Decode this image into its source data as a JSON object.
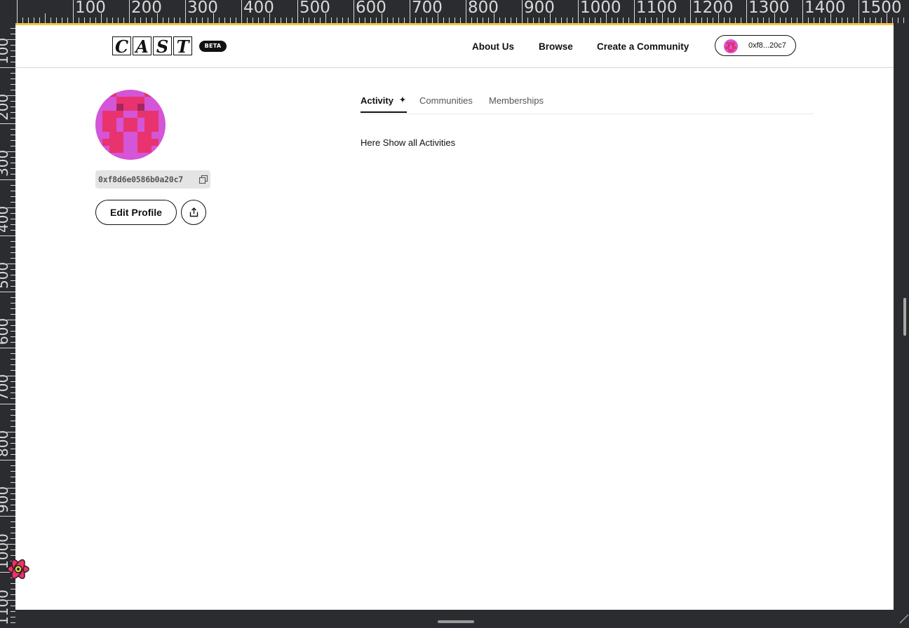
{
  "ruler": {
    "top_labels": [
      "100",
      "200",
      "300",
      "400",
      "500",
      "600",
      "700",
      "800",
      "900",
      "1000",
      "1100",
      "1200",
      "1300",
      "1400",
      "1500"
    ],
    "left_labels": [
      "100",
      "200",
      "300",
      "400",
      "500",
      "600",
      "700",
      "800",
      "900",
      "1000",
      "1100"
    ]
  },
  "header": {
    "logo_letters": [
      "C",
      "A",
      "S",
      "T"
    ],
    "beta_label": "BETA",
    "nav": {
      "about": "About Us",
      "browse": "Browse",
      "create": "Create a Community"
    },
    "wallet": {
      "address_short": "0xf8...20c7"
    }
  },
  "profile": {
    "address": "0xf8d6e0586b0a20c7",
    "edit_label": "Edit Profile"
  },
  "tabs": [
    {
      "label": "Activity",
      "active": true
    },
    {
      "label": "Communities",
      "active": false
    },
    {
      "label": "Memberships",
      "active": false
    }
  ],
  "activity": {
    "content": "Here Show all Activities"
  },
  "colors": {
    "accent": "#f5c542",
    "avatar_magenta": "#d455d8",
    "avatar_pink": "#e8336f",
    "avatar_dark": "#a3265e",
    "chrome": "#2b2c30"
  },
  "icons": {
    "copy": "copy-icon",
    "share": "share-icon",
    "spark": "sparkle-icon",
    "react": "react-devtools-icon"
  }
}
